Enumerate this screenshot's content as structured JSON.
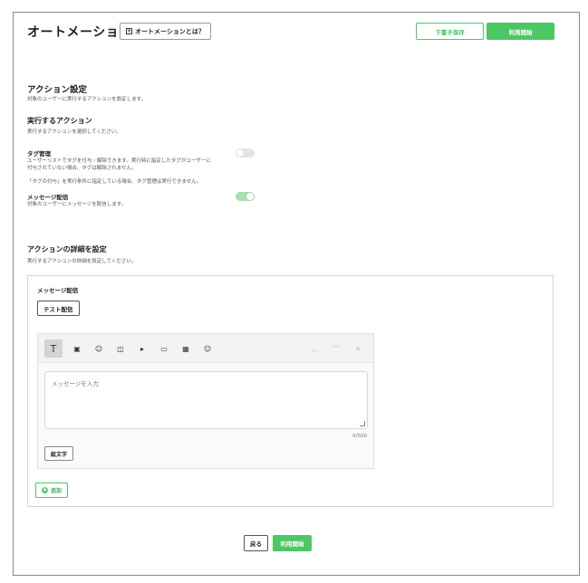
{
  "header": {
    "title": "オートメーション",
    "help_label": "オートメーションとは？",
    "draft_label": "下書き保存",
    "start_label": "利用開始"
  },
  "action_settings": {
    "heading": "アクション設定",
    "description": "対象のユーザーに実行するアクションを設定します。",
    "execute": {
      "heading": "実行するアクション",
      "description": "実行するアクションを選択してください。"
    },
    "tag_management": {
      "label": "タグ管理",
      "description_line1": "ユーザーリストでタグを付与・解除できます。実行時に指定したタグがユーザーに",
      "description_line2": "付与されていない場合、タグは解除されません。",
      "note": "「タグの付与」を実行条件に指定している場合、タグ管理は実行できません。",
      "enabled": false
    },
    "message_delivery": {
      "label": "メッセージ配信",
      "description": "対象のユーザーにメッセージを配信します。",
      "enabled": true
    }
  },
  "details": {
    "heading": "アクションの詳細を設定",
    "description": "実行するアクションの詳細を設定してください。"
  },
  "panel": {
    "title": "メッセージ配信",
    "test_label": "テスト配信",
    "editor": {
      "tools": [
        {
          "name": "text-icon",
          "glyph": "T",
          "active": true
        },
        {
          "name": "image-icon",
          "glyph": "▣"
        },
        {
          "name": "stamp-icon",
          "glyph": "☺"
        },
        {
          "name": "coupon-icon",
          "glyph": "◫"
        },
        {
          "name": "video-icon",
          "glyph": "▸"
        },
        {
          "name": "card-icon",
          "glyph": "▭"
        },
        {
          "name": "rich-message-icon",
          "glyph": "▦"
        },
        {
          "name": "emoji-icon",
          "glyph": "☺"
        }
      ],
      "placeholder": "メッセージを入力",
      "counter": "0/500",
      "emoji_label": "絵文字"
    },
    "add_label": "追加"
  },
  "footer": {
    "back_label": "戻る",
    "start_label": "利用開始"
  },
  "colors": {
    "accent": "#4cc764",
    "toggle_on": "#a7dfb1",
    "toggle_off": "#e4e4e4"
  }
}
